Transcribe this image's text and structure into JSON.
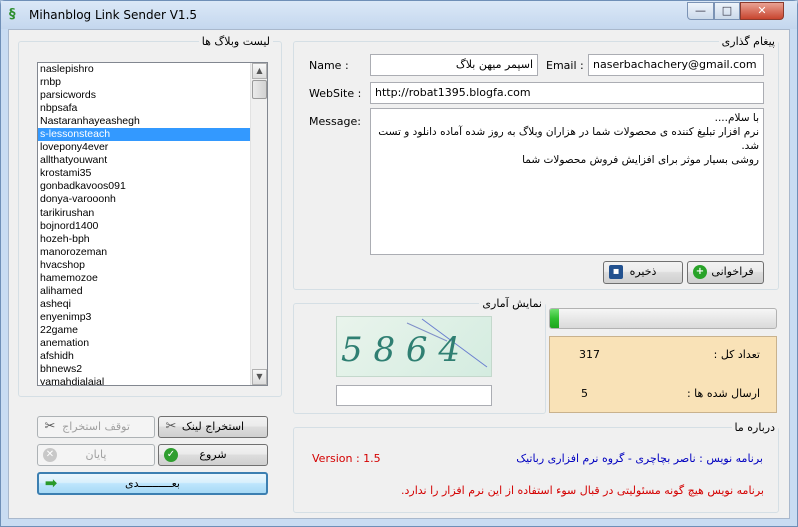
{
  "window": {
    "title": "Mihanblog Link Sender V1.5",
    "min_glyph": "—",
    "max_glyph": "□",
    "close_glyph": "✕"
  },
  "blog_list": {
    "legend": "لیست وبلاگ ها",
    "items": [
      "naslepishro",
      "rnbp",
      "parsicwords",
      "nbpsafa",
      "Nastaranhayeashegh",
      "s-lessonsteach",
      "lovepony4ever",
      "allthatyouwant",
      "krostami35",
      "gonbadkavoos091",
      "donya-varooonh",
      "tarikirushan",
      "bojnord1400",
      "hozeh-bph",
      "manorozeman",
      "hvacshop",
      "hamemozoe",
      "alihamed",
      "asheqi",
      "enyenimp3",
      "22game",
      "anemation",
      "afshidh",
      "bhnews2",
      "yamahdialajal"
    ],
    "selected_index": 5,
    "scroll_up_glyph": "▲",
    "scroll_down_glyph": "▼"
  },
  "buttons": {
    "stop_extract": "توقف استخراج",
    "extract_links": "استخراج لینک",
    "end": "پایان",
    "start": "شروع",
    "next": "بعــــــــــدی",
    "load": "فراخوانی",
    "save": "ذخیره"
  },
  "post": {
    "legend": "پیغام گذاری",
    "name_label": "Name :",
    "name_value": "اسپمر میهن بلاگ",
    "email_label": "Email :",
    "email_value": "naserbachachery@gmail.com",
    "website_label": "WebSite :",
    "website_value": "http://robat1395.blogfa.com",
    "message_label": "Message:",
    "message_value": "با سلام....\nنرم افزار تبلیغ کننده ی محصولات شما در هزاران وبلاگ به روز شده آماده دانلود و تست شد.\nروشی بسیار موثر برای افزایش فروش محصولات شما"
  },
  "captcha": {
    "legend": "نمایش آماری",
    "text": "5 8 6 4"
  },
  "progress": {
    "value": 0.04
  },
  "stats": {
    "total_label": "تعداد کل :",
    "total_value": "317",
    "sent_label": "ارسال شده ها :",
    "sent_value": "5"
  },
  "about": {
    "legend": "درباره ما",
    "author": "برنامه نویس :   ناصر بچاچری - گروه نرم افزاری رباتیک",
    "version": "Version : 1.5",
    "disclaimer": "برنامه نویس هیچ گونه مسئولیتی در قبال سوء استفاده از این نرم افزار را ندارد."
  },
  "colors": {
    "title_bg": "#c4d7ee",
    "list_selection": "#3399ff",
    "stats_bg": "#f9e2b7",
    "progress": "#2fbf2f",
    "about_red": "#d40000",
    "about_blue": "#0000c0"
  }
}
